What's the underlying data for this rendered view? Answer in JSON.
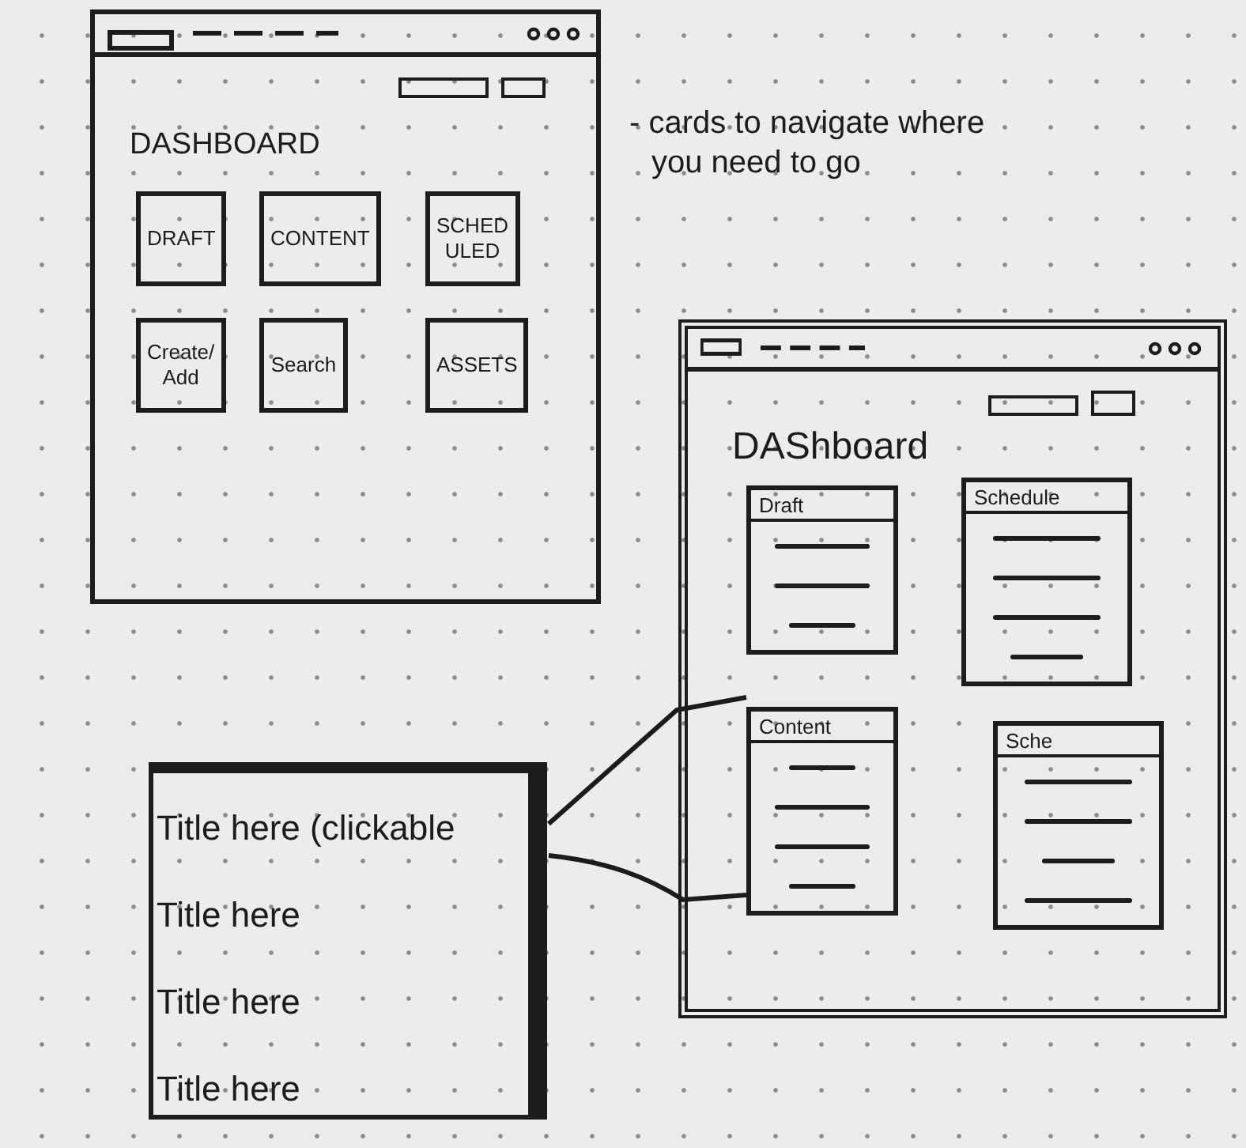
{
  "dashboard_sketch": {
    "title": "DASHBOARD",
    "cards": [
      {
        "label": "DRAFT"
      },
      {
        "label": "CONTENT"
      },
      {
        "label": "SCHED ULED"
      },
      {
        "label": "Create/ Add"
      },
      {
        "label": "Search"
      },
      {
        "label": "ASSETS"
      }
    ]
  },
  "note": {
    "text": "- cards to navigate where you need to go"
  },
  "dashboard_detail_sketch": {
    "title": "DAShboard",
    "cards": [
      {
        "title": "Draft",
        "lines": [
          {
            "kind": "long"
          },
          {
            "kind": "long"
          },
          {
            "kind": "short"
          }
        ]
      },
      {
        "title": "Schedule",
        "lines": [
          {
            "kind": "long"
          },
          {
            "kind": "long"
          },
          {
            "kind": "long"
          },
          {
            "kind": "short"
          }
        ]
      },
      {
        "title": "Content",
        "lines": [
          {
            "kind": "short"
          },
          {
            "kind": "long"
          },
          {
            "kind": "long"
          },
          {
            "kind": "short"
          }
        ]
      },
      {
        "title": "Sche",
        "lines": [
          {
            "kind": "long"
          },
          {
            "kind": "long"
          },
          {
            "kind": "short"
          },
          {
            "kind": "long"
          }
        ]
      }
    ]
  },
  "callout": {
    "items": [
      "Title here (clickable",
      "Title here",
      "Title here",
      "Title here"
    ]
  }
}
